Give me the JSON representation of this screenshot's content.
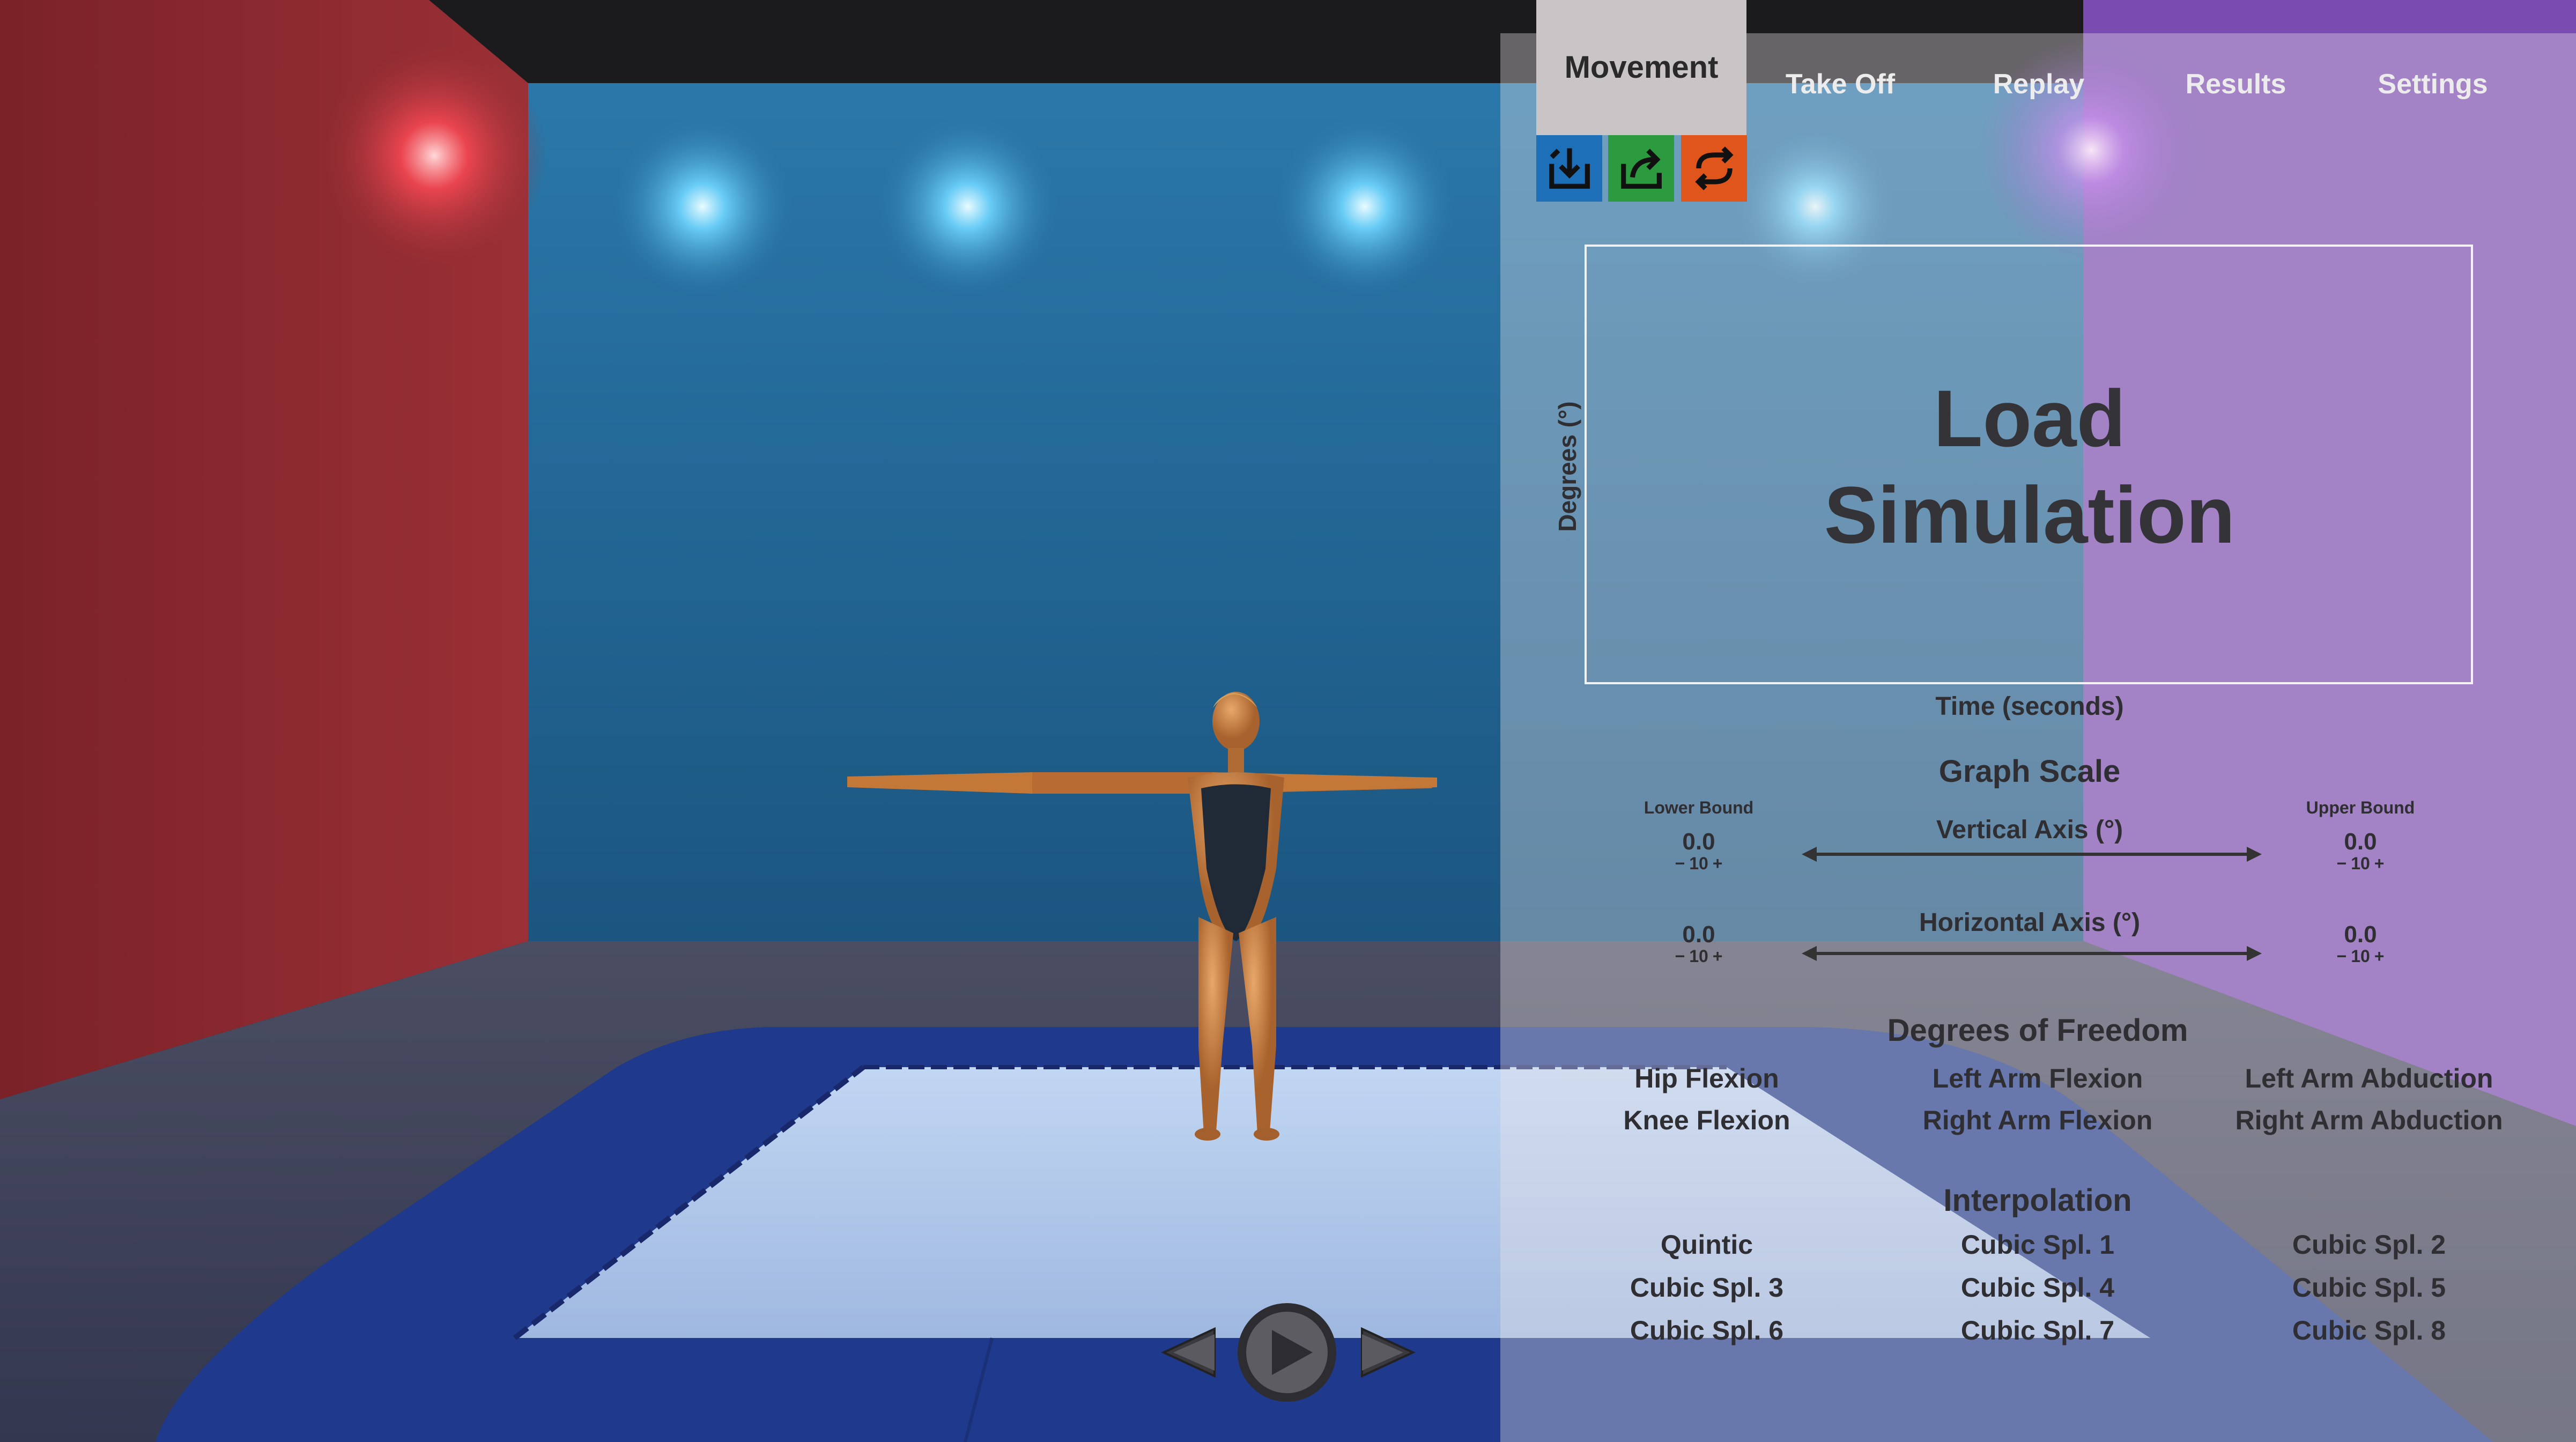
{
  "tabs": [
    {
      "label": "Movement",
      "active": true
    },
    {
      "label": "Take Off",
      "active": false
    },
    {
      "label": "Replay",
      "active": false
    },
    {
      "label": "Results",
      "active": false
    },
    {
      "label": "Settings",
      "active": false
    }
  ],
  "toolbar": {
    "load_icon": "load-icon",
    "save_icon": "save-icon",
    "reset_icon": "reset-icon",
    "colors": {
      "load": "#1d6fb8",
      "save": "#2c9a3e",
      "reset": "#e0551c"
    }
  },
  "graph": {
    "placeholder": "Load\nSimulation",
    "placeholder_line1": "Load",
    "placeholder_line2": "Simulation",
    "ylabel": "Degrees (°)",
    "xlabel": "Time (seconds)"
  },
  "graph_scale": {
    "title": "Graph Scale",
    "lower_bound_label": "Lower Bound",
    "upper_bound_label": "Upper Bound",
    "vertical": {
      "label": "Vertical Axis (°)",
      "lower": "0.0",
      "upper": "0.0",
      "step_minus": "−",
      "step": "10",
      "step_plus": "+"
    },
    "horizontal": {
      "label": "Horizontal Axis (°)",
      "lower": "0.0",
      "upper": "0.0",
      "step_minus": "−",
      "step": "10",
      "step_plus": "+"
    }
  },
  "degrees_of_freedom": {
    "title": "Degrees of Freedom",
    "items": [
      "Hip Flexion",
      "Left Arm Flexion",
      "Left Arm Abduction",
      "Knee Flexion",
      "Right Arm Flexion",
      "Right Arm Abduction"
    ]
  },
  "interpolation": {
    "title": "Interpolation",
    "items": [
      "Quintic",
      "Cubic Spl. 1",
      "Cubic Spl. 2",
      "Cubic Spl. 3",
      "Cubic Spl. 4",
      "Cubic Spl. 5",
      "Cubic Spl. 6",
      "Cubic Spl. 7",
      "Cubic Spl. 8"
    ]
  },
  "playback": {
    "prev_icon": "previous-icon",
    "play_icon": "play-icon",
    "next_icon": "next-icon"
  },
  "scene_colors": {
    "back_wall": "#1e5f8a",
    "left_wall": "#8e2c34",
    "floor": "#3a3f5c",
    "trampoline_frame": "#1f3a8c",
    "trampoline_bed": "#b7cdee"
  }
}
